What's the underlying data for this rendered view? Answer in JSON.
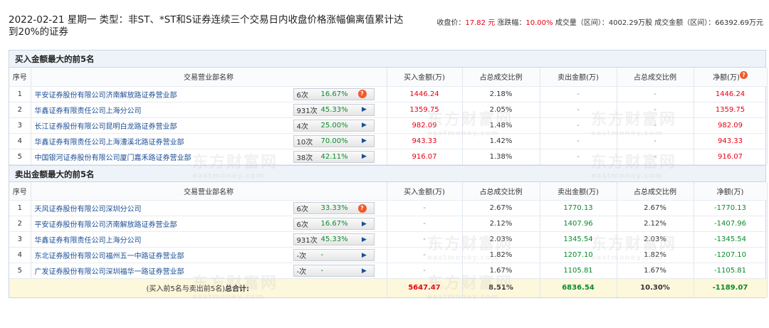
{
  "header": {
    "title": "2022-02-21 星期一 类型：非ST、*ST和S证券连续三个交易日内收盘价格涨幅偏离值累计达到20%的证券",
    "close_label": "收盘价：",
    "close_value": "17.82 元",
    "change_label": "涨跌幅：",
    "change_value": "10.00%",
    "volume_label": "成交量（区间）：",
    "volume_value": "4002.29万股",
    "amount_label": "成交金额（区间）：",
    "amount_value": "66392.69万元"
  },
  "columns": {
    "seq": "序号",
    "name": "交易营业部名称",
    "buy": "买入金额(万)",
    "buy_ratio": "占总成交比例",
    "sell": "卖出金额(万)",
    "sell_ratio": "占总成交比例",
    "net": "净额(万)"
  },
  "buy_section": {
    "title": "买入金额最大的前5名",
    "rows": [
      {
        "seq": "1",
        "name": "平安证券股份有限公司济南解放路证券营业部",
        "count": "6次",
        "pct": "16.67%",
        "icon": "question-icon",
        "buy": "1446.24",
        "buy_ratio": "2.18%",
        "sell": "-",
        "sell_ratio": "-",
        "net": "1446.24"
      },
      {
        "seq": "2",
        "name": "华鑫证券有限责任公司上海分公司",
        "count": "931次",
        "pct": "45.33%",
        "icon": "arrow-right-icon",
        "buy": "1359.75",
        "buy_ratio": "2.05%",
        "sell": "-",
        "sell_ratio": "-",
        "net": "1359.75"
      },
      {
        "seq": "3",
        "name": "长江证券股份有限公司昆明白龙路证券营业部",
        "count": "4次",
        "pct": "25.00%",
        "icon": "arrow-right-icon",
        "buy": "982.09",
        "buy_ratio": "1.48%",
        "sell": "-",
        "sell_ratio": "-",
        "net": "982.09"
      },
      {
        "seq": "4",
        "name": "华鑫证券有限责任公司上海漕溪北路证券营业部",
        "count": "10次",
        "pct": "70.00%",
        "icon": "arrow-right-icon",
        "buy": "943.33",
        "buy_ratio": "1.42%",
        "sell": "-",
        "sell_ratio": "-",
        "net": "943.33"
      },
      {
        "seq": "5",
        "name": "中国银河证券股份有限公司厦门嘉禾路证券营业部",
        "count": "38次",
        "pct": "42.11%",
        "icon": "arrow-right-icon",
        "buy": "916.07",
        "buy_ratio": "1.38%",
        "sell": "-",
        "sell_ratio": "-",
        "net": "916.07"
      }
    ]
  },
  "sell_section": {
    "title": "卖出金额最大的前5名",
    "rows": [
      {
        "seq": "1",
        "name": "天风证券股份有限公司深圳分公司",
        "count": "6次",
        "pct": "33.33%",
        "icon": "question-icon",
        "buy": "-",
        "buy_ratio": "2.67%",
        "sell": "1770.13",
        "sell_ratio": "2.67%",
        "net": "-1770.13"
      },
      {
        "seq": "2",
        "name": "平安证券股份有限公司济南解放路证券营业部",
        "count": "6次",
        "pct": "16.67%",
        "icon": "arrow-right-icon",
        "buy": "-",
        "buy_ratio": "2.12%",
        "sell": "1407.96",
        "sell_ratio": "2.12%",
        "net": "-1407.96"
      },
      {
        "seq": "3",
        "name": "华鑫证券有限责任公司上海分公司",
        "count": "931次",
        "pct": "45.33%",
        "icon": "arrow-right-icon",
        "buy": "-",
        "buy_ratio": "2.03%",
        "sell": "1345.54",
        "sell_ratio": "2.03%",
        "net": "-1345.54"
      },
      {
        "seq": "4",
        "name": "东北证券股份有限公司福州五一中路证券营业部",
        "count": "-次",
        "pct": "-",
        "icon": "arrow-right-icon",
        "buy": "-",
        "buy_ratio": "1.82%",
        "sell": "1207.10",
        "sell_ratio": "1.82%",
        "net": "-1207.10"
      },
      {
        "seq": "5",
        "name": "广发证券股份有限公司深圳福华一路证券营业部",
        "count": "-次",
        "pct": "-",
        "icon": "arrow-right-icon",
        "buy": "-",
        "buy_ratio": "1.67%",
        "sell": "1105.81",
        "sell_ratio": "1.67%",
        "net": "-1105.81"
      }
    ]
  },
  "total": {
    "label_prefix": "(买入前5名与卖出前5名)",
    "label_bold": "总合计:",
    "buy": "5647.47",
    "buy_ratio": "8.51%",
    "sell": "6836.54",
    "sell_ratio": "10.30%",
    "net": "-1189.07"
  },
  "watermark": {
    "cn": "东方财富网",
    "en": "eastmoney.com"
  },
  "colors": {
    "up": "#e60012",
    "down": "#0a8a2a",
    "link": "#1b4e95",
    "accent": "#f05a28"
  }
}
